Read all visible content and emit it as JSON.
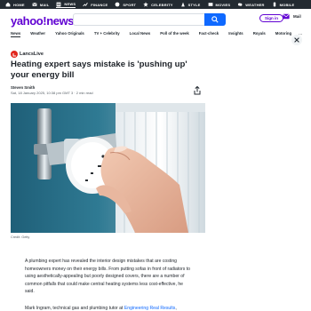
{
  "topbar": {
    "items": [
      {
        "label": "HOME",
        "icon": "home-icon"
      },
      {
        "label": "MAIL",
        "icon": "mail-icon"
      },
      {
        "label": "NEWS",
        "icon": "news-icon"
      },
      {
        "label": "FINANCE",
        "icon": "finance-icon"
      },
      {
        "label": "SPORT",
        "icon": "sport-icon"
      },
      {
        "label": "CELEBRITY",
        "icon": "star-icon"
      },
      {
        "label": "STYLE",
        "icon": "style-icon"
      },
      {
        "label": "MOVIES",
        "icon": "movies-icon"
      },
      {
        "label": "WEATHER",
        "icon": "weather-icon"
      },
      {
        "label": "MOBILE",
        "icon": "mobile-icon"
      }
    ],
    "active": "NEWS",
    "background": "#232a31"
  },
  "header": {
    "logo": "yahoo!news",
    "brand_color": "#6001d2",
    "search_placeholder": "",
    "search_button_color": "#0f69ff",
    "signin_label": "Sign in",
    "mail_label": "Mail"
  },
  "subnav": {
    "items": [
      "News",
      "Weather",
      "Yahoo Originals",
      "TV + Celebrity",
      "Local News",
      "Poll of the week",
      "Fact-check",
      "Insights",
      "Royals",
      "Motoring"
    ],
    "active": "News",
    "more": "..."
  },
  "article": {
    "source": "LancsLive",
    "headline": "Heating expert says mistake is 'pushing up' your energy bill",
    "author": "Steven Smith",
    "dateline": "Sat, 18 January 2025, 10:38 pm GMT 3 · 2 min read",
    "image_credit": "Credit: Getty",
    "paragraph1": "A plumbing expert has revealed the interior design mistakes that are costing homeowners money on their energy bills. From putting sofas in front of radiators to using aesthetically-appealing but poorly designed covers, there are a number of common pitfalls that could make central heating systems less cost-effective, he said.",
    "paragraph2_prefix": "Mark Ingram, technical gas and plumbing tutor at ",
    "paragraph2_link": "Engineering Real Results",
    "paragraph2_suffix": ","
  }
}
